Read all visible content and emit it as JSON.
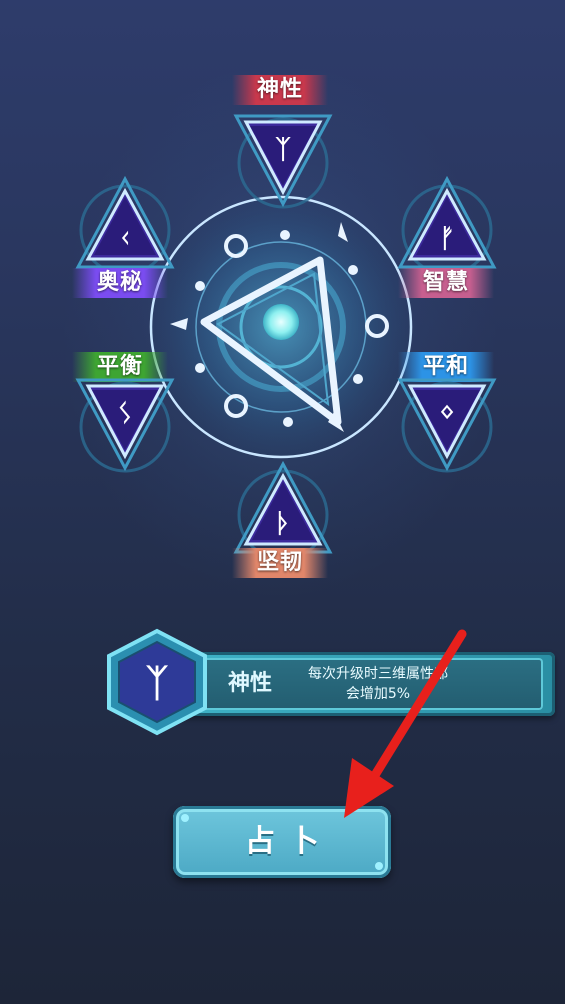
{
  "attributes": [
    {
      "key": "shenxing",
      "label": "神性",
      "color_top": "#e25063",
      "color_bottom": "#9e1f35",
      "rune": "ᛉ"
    },
    {
      "key": "zhihui",
      "label": "智慧",
      "color_top": "#e07aa8",
      "color_bottom": "#b24779",
      "rune": "ᚠ"
    },
    {
      "key": "pinghe",
      "label": "平和",
      "color_top": "#43b6ff",
      "color_bottom": "#1d77d8",
      "rune": "ᛜ"
    },
    {
      "key": "jianren",
      "label": "坚韧",
      "color_top": "#f0a084",
      "color_bottom": "#c96048",
      "rune": "ᚦ"
    },
    {
      "key": "pingheng",
      "label": "平衡",
      "color_top": "#4bbf3c",
      "color_bottom": "#2a8a22",
      "rune": "ᛊ"
    },
    {
      "key": "aomi",
      "label": "奥秘",
      "color_top": "#8a58ff",
      "color_bottom": "#5a2fcf",
      "rune": "ᚲ"
    }
  ],
  "info": {
    "name": "神性",
    "description_line1": "每次升级时三维属性都",
    "description_line2": "会增加5%",
    "icon": "algiz-rune-icon"
  },
  "divine_button": {
    "label": "占卜"
  },
  "colors": {
    "accent": "#6fc7dd",
    "arrow": "#e8201c",
    "panel": "#3fb3c7"
  }
}
